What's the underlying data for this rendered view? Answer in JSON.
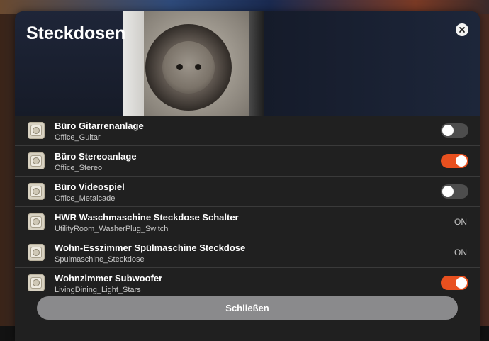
{
  "dialog": {
    "title": "Steckdosen",
    "close_icon": "close-icon",
    "hero_image": "power-socket-photo",
    "footer_button_label": "Schließen"
  },
  "items": [
    {
      "name": "Büro Gitarrenanlage",
      "id": "Office_Guitar",
      "control": "toggle",
      "state": "off",
      "icon": "power-socket-icon"
    },
    {
      "name": "Büro Stereoanlage",
      "id": "Office_Stereo",
      "control": "toggle",
      "state": "on",
      "icon": "power-socket-icon"
    },
    {
      "name": "Büro Videospiel",
      "id": "Office_Metalcade",
      "control": "toggle",
      "state": "off",
      "icon": "power-socket-icon"
    },
    {
      "name": "HWR Waschmaschine Steckdose Schalter",
      "id": "UtilityRoom_WasherPlug_Switch",
      "control": "text",
      "state_text": "ON",
      "icon": "power-socket-icon"
    },
    {
      "name": "Wohn-Esszimmer Spülmaschine Steckdose",
      "id": "Spulmaschine_Steckdose",
      "control": "text",
      "state_text": "ON",
      "icon": "power-socket-icon"
    },
    {
      "name": "Wohnzimmer Subwoofer",
      "id": "LivingDining_Light_Stars",
      "control": "toggle",
      "state": "on",
      "icon": "power-socket-icon"
    }
  ],
  "colors": {
    "toggle_on": "#e8501f",
    "toggle_off": "#4d4d4d",
    "dialog_bg": "#202020"
  }
}
